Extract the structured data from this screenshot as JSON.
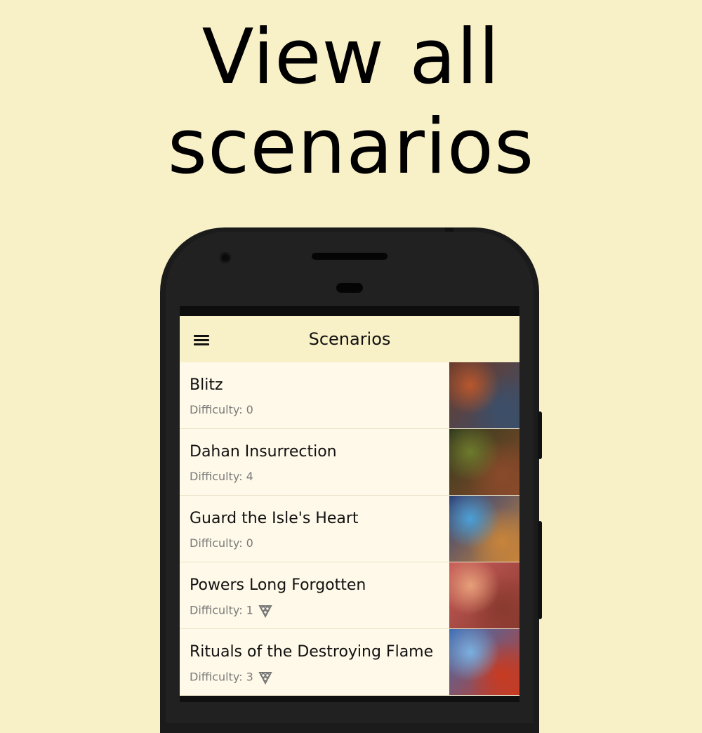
{
  "headline": {
    "line1": "View all",
    "line2": "scenarios"
  },
  "appbar": {
    "title": "Scenarios",
    "menu_icon": "hamburger-menu-icon"
  },
  "scenarios": [
    {
      "name": "Blitz",
      "difficulty": "Difficulty: 0",
      "expansion_icon": false,
      "thumb_colors": [
        "#6b3a2a",
        "#b8572c",
        "#3b4f6a"
      ]
    },
    {
      "name": "Dahan Insurrection",
      "difficulty": "Difficulty: 4",
      "expansion_icon": false,
      "thumb_colors": [
        "#2f3a1e",
        "#6d7a2c",
        "#8a4a2a"
      ]
    },
    {
      "name": "Guard the Isle's Heart",
      "difficulty": "Difficulty: 0",
      "expansion_icon": false,
      "thumb_colors": [
        "#2a3f7a",
        "#4aa0d8",
        "#c8843a"
      ]
    },
    {
      "name": "Powers Long Forgotten",
      "difficulty": "Difficulty: 1",
      "expansion_icon": true,
      "thumb_colors": [
        "#c85c5a",
        "#e7a07a",
        "#8a3a30"
      ]
    },
    {
      "name": "Rituals of the Destroying Flame",
      "difficulty": "Difficulty: 3",
      "expansion_icon": true,
      "thumb_colors": [
        "#3c6fb8",
        "#7ab0e0",
        "#c83a20"
      ]
    }
  ]
}
